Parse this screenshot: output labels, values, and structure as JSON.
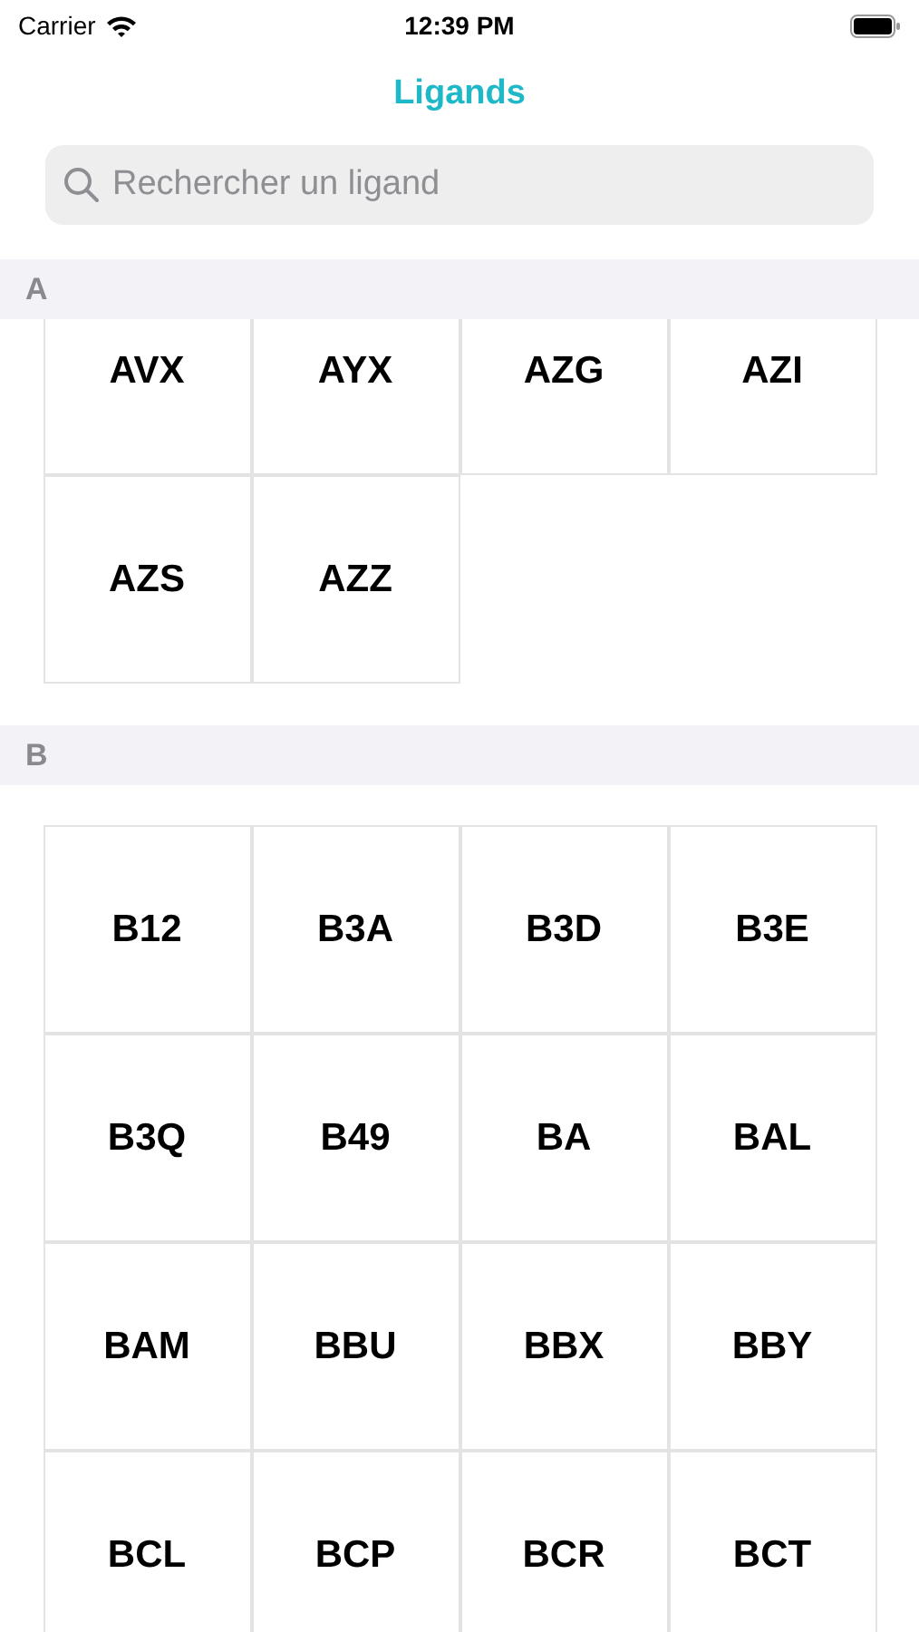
{
  "status_bar": {
    "carrier": "Carrier",
    "time": "12:39 PM"
  },
  "nav": {
    "title": "Ligands"
  },
  "search": {
    "placeholder": "Rechercher un ligand"
  },
  "sections": [
    {
      "letter": "A",
      "ligands": [
        "AVX",
        "AYX",
        "AZG",
        "AZI",
        "AZS",
        "AZZ"
      ]
    },
    {
      "letter": "B",
      "ligands": [
        "B12",
        "B3A",
        "B3D",
        "B3E",
        "B3Q",
        "B49",
        "BA",
        "BAL",
        "BAM",
        "BBU",
        "BBX",
        "BBY",
        "BCL",
        "BCP",
        "BCR",
        "BCT"
      ]
    }
  ]
}
